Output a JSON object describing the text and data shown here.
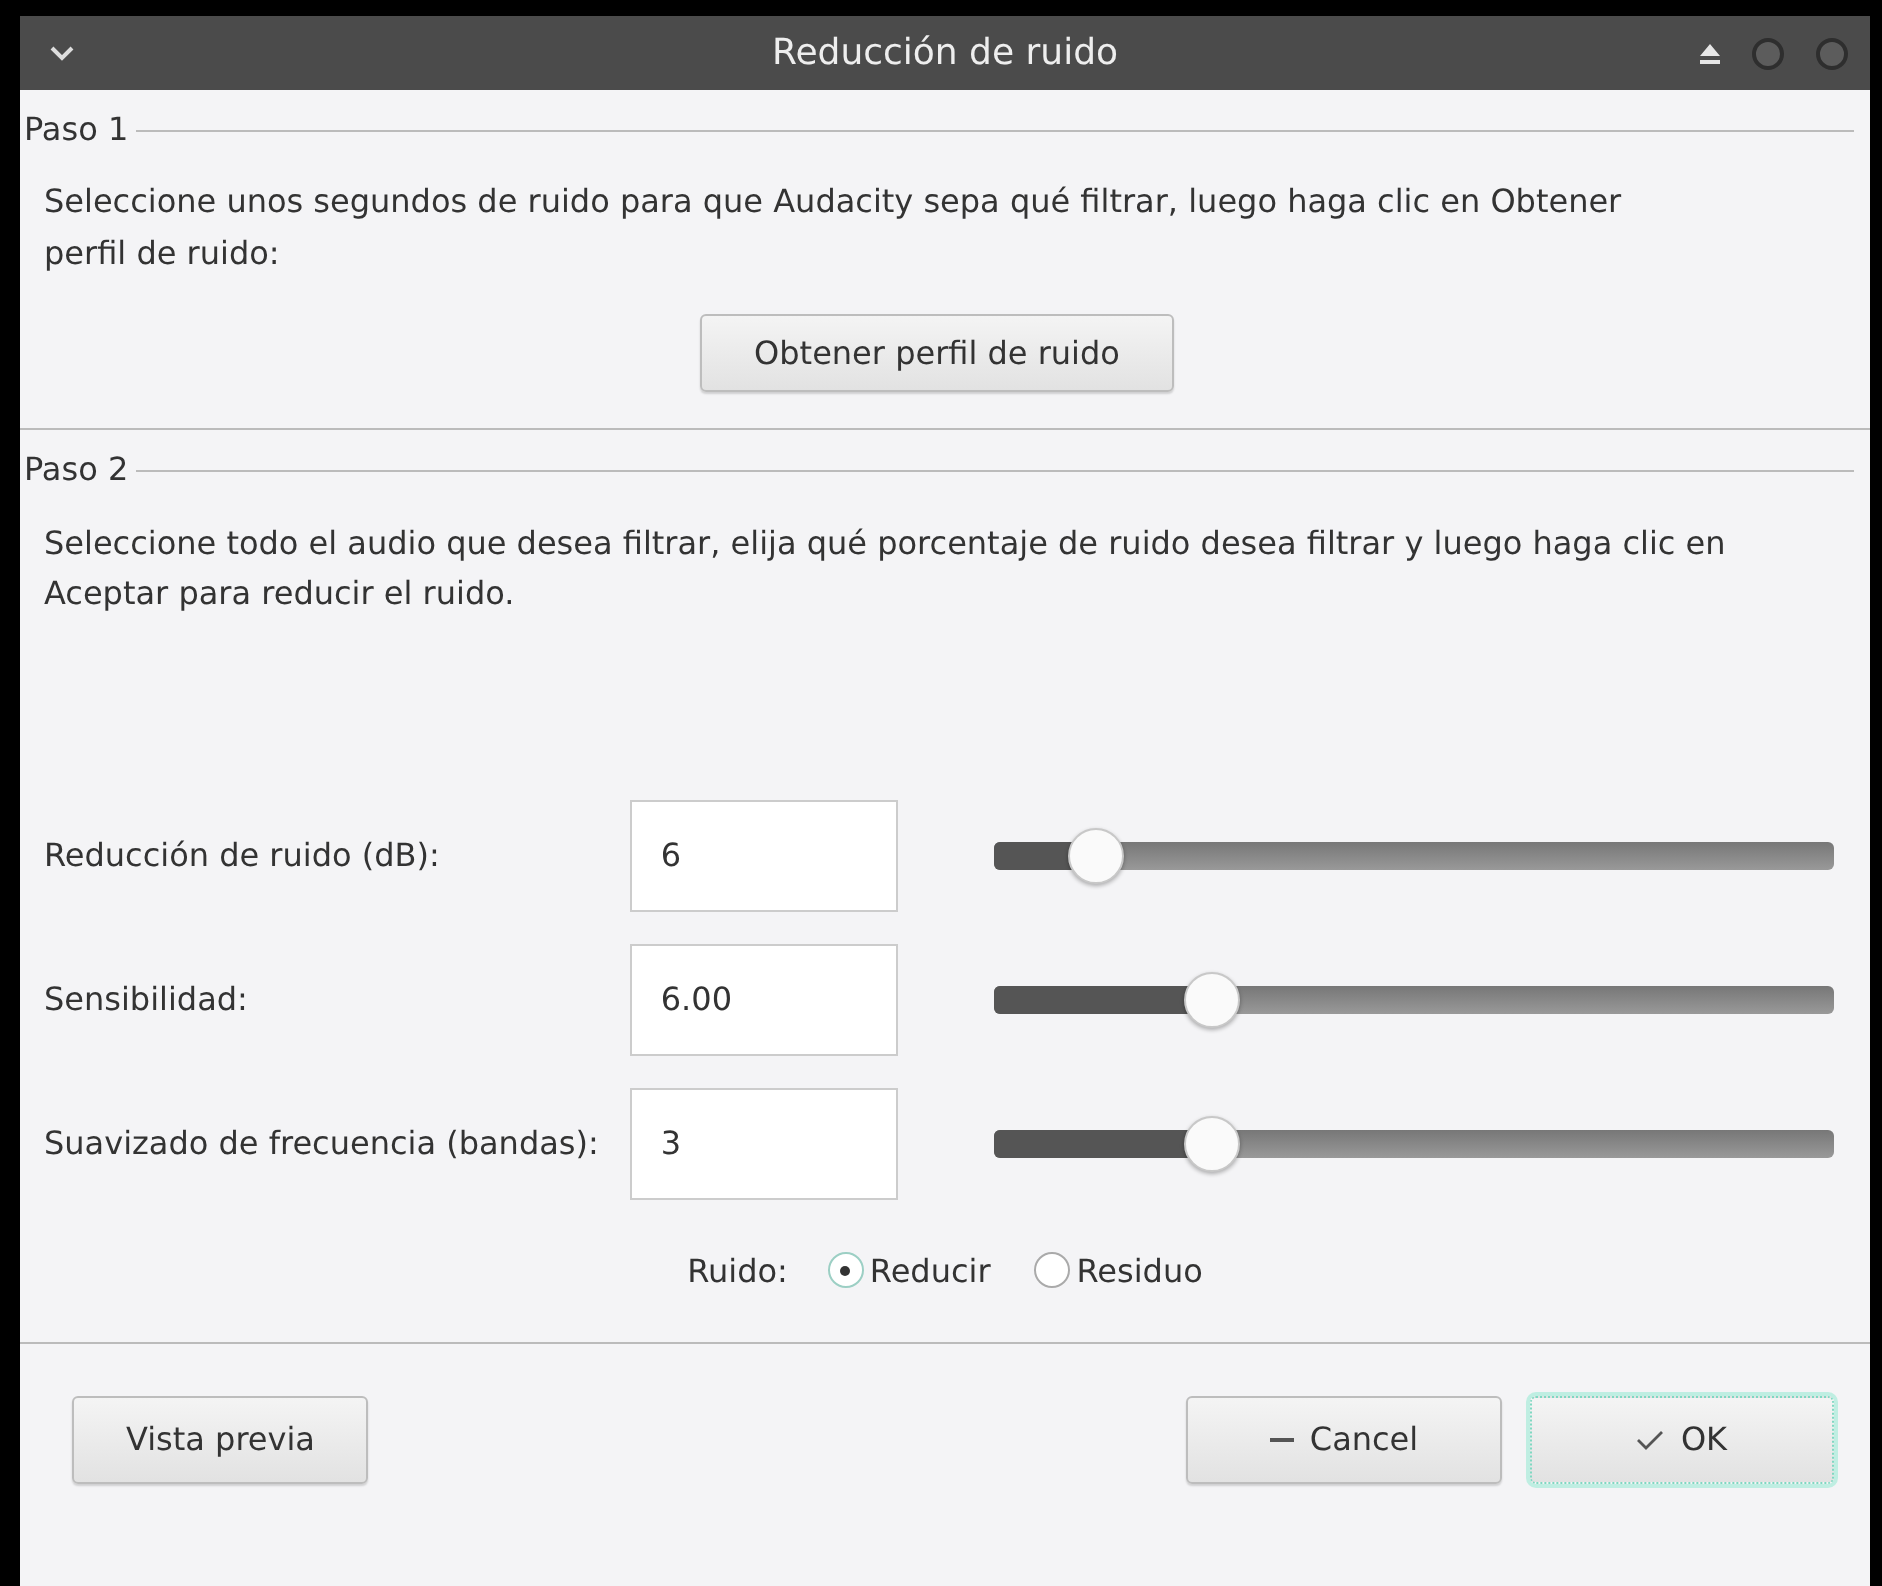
{
  "window": {
    "title": "Reducción de ruido"
  },
  "steps": [
    {
      "label": "Paso 1",
      "text": "Seleccione unos segundos de ruido para que Audacity sepa qué filtrar, luego haga clic en Obtener perfil de ruido:",
      "button": "Obtener perfil de ruido"
    },
    {
      "label": "Paso 2",
      "text": "Seleccione todo el audio que desea filtrar, elija qué porcentaje de ruido desea filtrar y luego haga clic en Aceptar para reducir el ruido."
    }
  ],
  "params": [
    {
      "label": "Reducción de ruido (dB):",
      "value": "6",
      "level": 0.12
    },
    {
      "label": "Sensibilidad:",
      "value": "6.00",
      "level": 0.26
    },
    {
      "label": "Suavizado de frecuencia (bandas):",
      "value": "3",
      "level": 0.26
    }
  ],
  "noise": {
    "label": "Ruido:",
    "options": [
      {
        "label": "Reducir",
        "selected": true
      },
      {
        "label": "Residuo",
        "selected": false
      }
    ]
  },
  "buttons": [
    {
      "label": "Vista previa",
      "kind": "plain"
    },
    {
      "label": "Cancel",
      "kind": "cancel"
    },
    {
      "label": "OK",
      "kind": "ok"
    }
  ]
}
